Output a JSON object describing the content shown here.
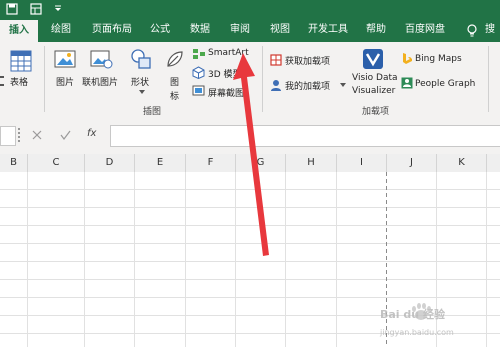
{
  "ribbon_tabs": [
    "插入",
    "绘图",
    "页面布局",
    "公式",
    "数据",
    "审阅",
    "视图",
    "开发工具",
    "帮助",
    "百度网盘",
    "搜"
  ],
  "illustrations": {
    "table_label": "表格",
    "picture": "图片",
    "online_picture": "联机图片",
    "shapes": "形状",
    "icons_line1": "图",
    "icons_line2": "标",
    "smartart": "SmartArt",
    "model3d": "3D 模型",
    "screenshot": "屏幕截图",
    "group_label": "插图"
  },
  "addins": {
    "get_addins": "获取加载项",
    "my_addins": "我的加载项",
    "visio_line1": "Visio Data",
    "visio_line2": "Visualizer",
    "bing_maps": "Bing Maps",
    "people_graph": "People Graph",
    "group_label": "加载项"
  },
  "formula_bar": {
    "fx": "fx",
    "value": ""
  },
  "columns": [
    "B",
    "C",
    "D",
    "E",
    "F",
    "G",
    "H",
    "I",
    "J",
    "K"
  ],
  "watermark": {
    "line1": "Bai du 经验",
    "line2": "jingyan.baidu.com"
  },
  "colors": {
    "ribbon_green": "#217346",
    "arrow_red": "#e8383d"
  }
}
